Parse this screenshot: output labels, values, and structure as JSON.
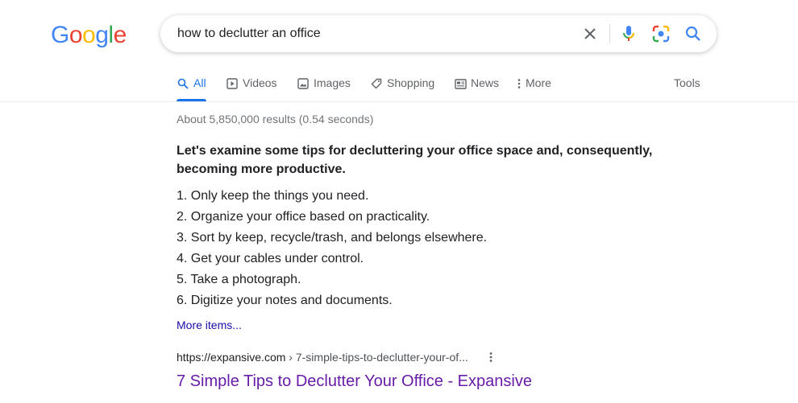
{
  "logo": {
    "letters": [
      "G",
      "o",
      "o",
      "g",
      "l",
      "e"
    ],
    "colors": [
      "#4285f4",
      "#ea4335",
      "#fbbc05",
      "#4285f4",
      "#34a853",
      "#ea4335"
    ]
  },
  "search": {
    "query": "how to declutter an office",
    "clear_icon": "close-icon",
    "voice_icon": "mic-icon",
    "lens_icon": "lens-icon",
    "search_icon": "search-icon"
  },
  "tabs": [
    {
      "label": "All",
      "icon": "search-icon",
      "active": true
    },
    {
      "label": "Videos",
      "icon": "video-icon",
      "active": false
    },
    {
      "label": "Images",
      "icon": "image-icon",
      "active": false
    },
    {
      "label": "Shopping",
      "icon": "tag-icon",
      "active": false
    },
    {
      "label": "News",
      "icon": "news-icon",
      "active": false
    },
    {
      "label": "More",
      "icon": "more-vert-icon",
      "active": false
    }
  ],
  "tools_label": "Tools",
  "stats": "About 5,850,000 results (0.54 seconds)",
  "snippet": {
    "title": "Let's examine some tips for decluttering your office space and, consequently, becoming more productive.",
    "items": [
      "1. Only keep the things you need.",
      "2. Organize your office based on practicality.",
      "3. Sort by keep, recycle/trash, and belongs elsewhere.",
      "4. Get your cables under control.",
      "5. Take a photograph.",
      "6. Digitize your notes and documents."
    ],
    "more_label": "More items..."
  },
  "result": {
    "site": "https://expansive.com",
    "path": " › 7-simple-tips-to-declutter-your-of...",
    "title": "7 Simple Tips to Declutter Your Office - Expansive"
  },
  "colors": {
    "accent": "#1a73e8",
    "visited_link": "#681da8",
    "link": "#1a0dab"
  }
}
